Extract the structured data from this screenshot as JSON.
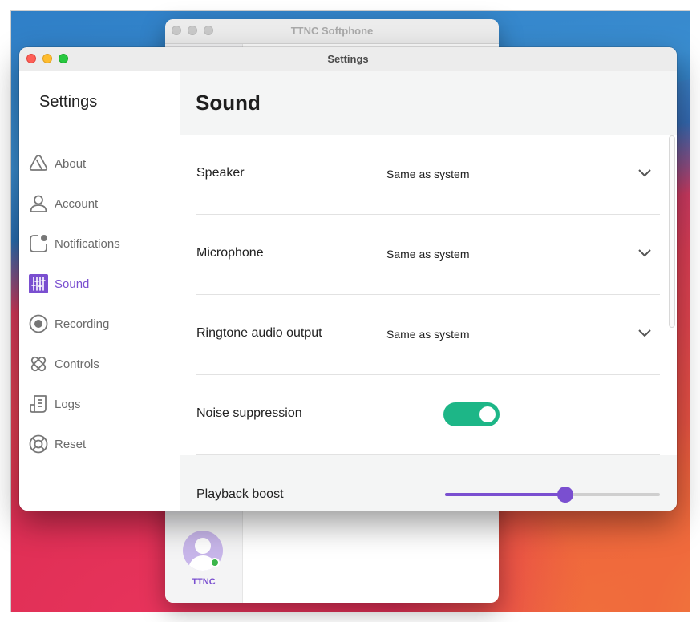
{
  "background_window": {
    "title": "TTNC Softphone",
    "user_label": "TTNC"
  },
  "window": {
    "title": "Settings"
  },
  "sidebar": {
    "title": "Settings",
    "items": [
      {
        "label": "About",
        "icon": "triangle-icon",
        "active": false
      },
      {
        "label": "Account",
        "icon": "user-icon",
        "active": false
      },
      {
        "label": "Notifications",
        "icon": "notification-icon",
        "active": false
      },
      {
        "label": "Sound",
        "icon": "sliders-icon",
        "active": true
      },
      {
        "label": "Recording",
        "icon": "record-icon",
        "active": false
      },
      {
        "label": "Controls",
        "icon": "controls-icon",
        "active": false
      },
      {
        "label": "Logs",
        "icon": "logs-icon",
        "active": false
      },
      {
        "label": "Reset",
        "icon": "lifebuoy-icon",
        "active": false
      }
    ]
  },
  "main": {
    "title": "Sound",
    "speaker": {
      "label": "Speaker",
      "value": "Same as system"
    },
    "microphone": {
      "label": "Microphone",
      "value": "Same as system"
    },
    "ringtone": {
      "label": "Ringtone audio output",
      "value": "Same as system"
    },
    "noise": {
      "label": "Noise suppression",
      "enabled": true
    },
    "boost": {
      "label": "Playback boost",
      "level": 0.56
    }
  },
  "colors": {
    "accent": "#7a4fd0",
    "toggle_on": "#1db687"
  }
}
